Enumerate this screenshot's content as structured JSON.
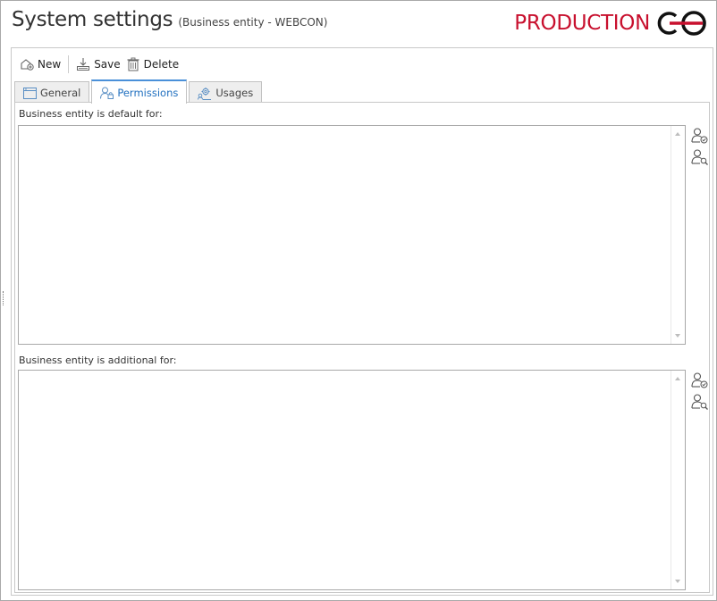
{
  "header": {
    "title": "System settings",
    "subtitle": "(Business entity - WEBCON)",
    "environment": "PRODUCTION",
    "environment_color": "#c8102e",
    "logo_icon": "webcon-logo-icon"
  },
  "toolbar": {
    "new_label": "New",
    "save_label": "Save",
    "delete_label": "Delete"
  },
  "tabs": [
    {
      "label": "General",
      "icon": "window-icon",
      "active": false
    },
    {
      "label": "Permissions",
      "icon": "user-lock-icon",
      "active": true
    },
    {
      "label": "Usages",
      "icon": "gear-users-icon",
      "active": false
    }
  ],
  "permissions": {
    "default_label": "Business entity is default for:",
    "additional_label": "Business entity is additional for:"
  },
  "colors": {
    "accent": "#4a90d9",
    "border": "#a8a8a8"
  }
}
